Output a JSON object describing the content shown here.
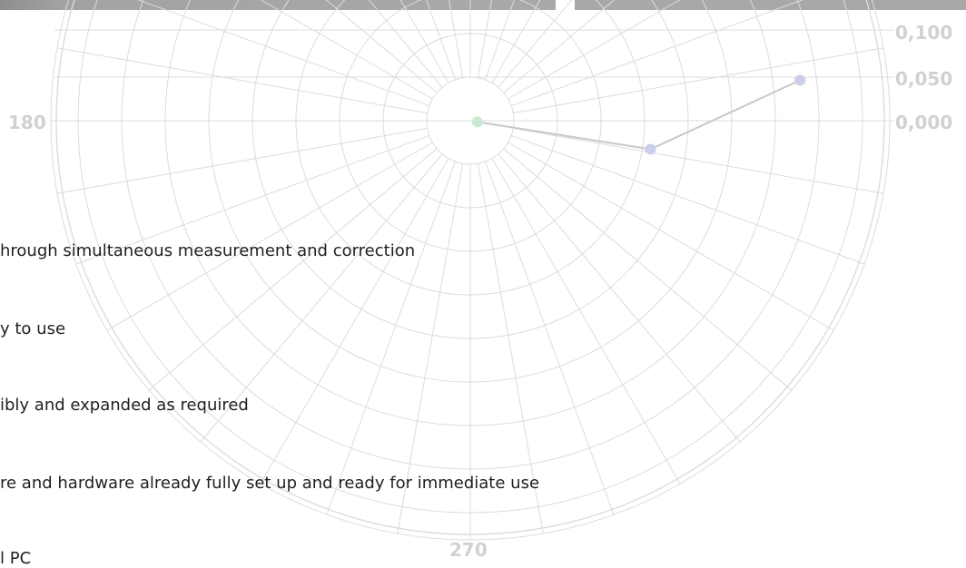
{
  "colors": {
    "grid": "#dcdcdc",
    "line": "#c8c8c8",
    "point_start": "#c9ead0",
    "point_other": "#c9cfea",
    "label": "#d1d1d1",
    "text": "#1f1f1f"
  },
  "chart_data": {
    "type": "polar-line",
    "angle_labels": [
      "180",
      "270"
    ],
    "radial_labels": [
      "0,100",
      "0,050",
      "0,000"
    ],
    "points": [
      {
        "angle": 350,
        "r": 0.0
      },
      {
        "angle": 351,
        "r": 0.05
      },
      {
        "angle": 7,
        "r": 0.1
      }
    ]
  },
  "features": [
    "hrough simultaneous measurement and correction",
    "y to use",
    "ibly and expanded as required",
    "re and hardware already fully set up and ready for immediate use",
    "l PC"
  ]
}
